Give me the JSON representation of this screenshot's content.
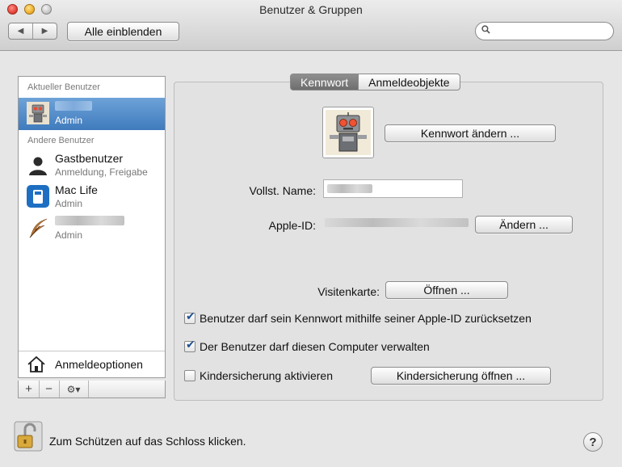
{
  "window": {
    "title": "Benutzer & Gruppen"
  },
  "toolbar": {
    "back_glyph": "◀",
    "forward_glyph": "▶",
    "show_all_label": "Alle einblenden",
    "search_placeholder": ""
  },
  "sidebar": {
    "current_header": "Aktueller Benutzer",
    "other_header": "Andere Benutzer",
    "users": [
      {
        "name": "",
        "role": "Admin",
        "icon": "robot-icon",
        "selected": true
      },
      {
        "name": "Gastbenutzer",
        "role": "Anmeldung, Freigabe",
        "icon": "guest-silhouette-icon"
      },
      {
        "name": "Mac Life",
        "role": "Admin",
        "icon": "mac-life-icon"
      },
      {
        "name": "",
        "role": "Admin",
        "icon": "feather-icon"
      }
    ],
    "login_options_label": "Anmeldeoptionen",
    "tools": {
      "add": "+",
      "remove": "−",
      "action": "⚙▾"
    }
  },
  "tabs": [
    {
      "label": "Kennwort",
      "active": true
    },
    {
      "label": "Anmeldeobjekte",
      "active": false
    }
  ],
  "main": {
    "change_password_label": "Kennwort ändern ...",
    "full_name_label": "Vollst. Name:",
    "full_name_value": "",
    "apple_id_label": "Apple-ID:",
    "apple_id_value": "",
    "change_apple_id_label": "Ändern ...",
    "vcard_label": "Visitenkarte:",
    "vcard_open_label": "Öffnen ...",
    "checks": [
      {
        "label": "Benutzer darf sein Kennwort mithilfe seiner Apple-ID zurücksetzen",
        "checked": true
      },
      {
        "label": "Der Benutzer darf diesen Computer verwalten",
        "checked": true
      },
      {
        "label": "Kindersicherung aktivieren",
        "checked": false
      }
    ],
    "parental_open_label": "Kindersicherung öffnen ..."
  },
  "footer": {
    "lock_text": "Zum Schützen auf das Schloss klicken.",
    "help_label": "?"
  }
}
